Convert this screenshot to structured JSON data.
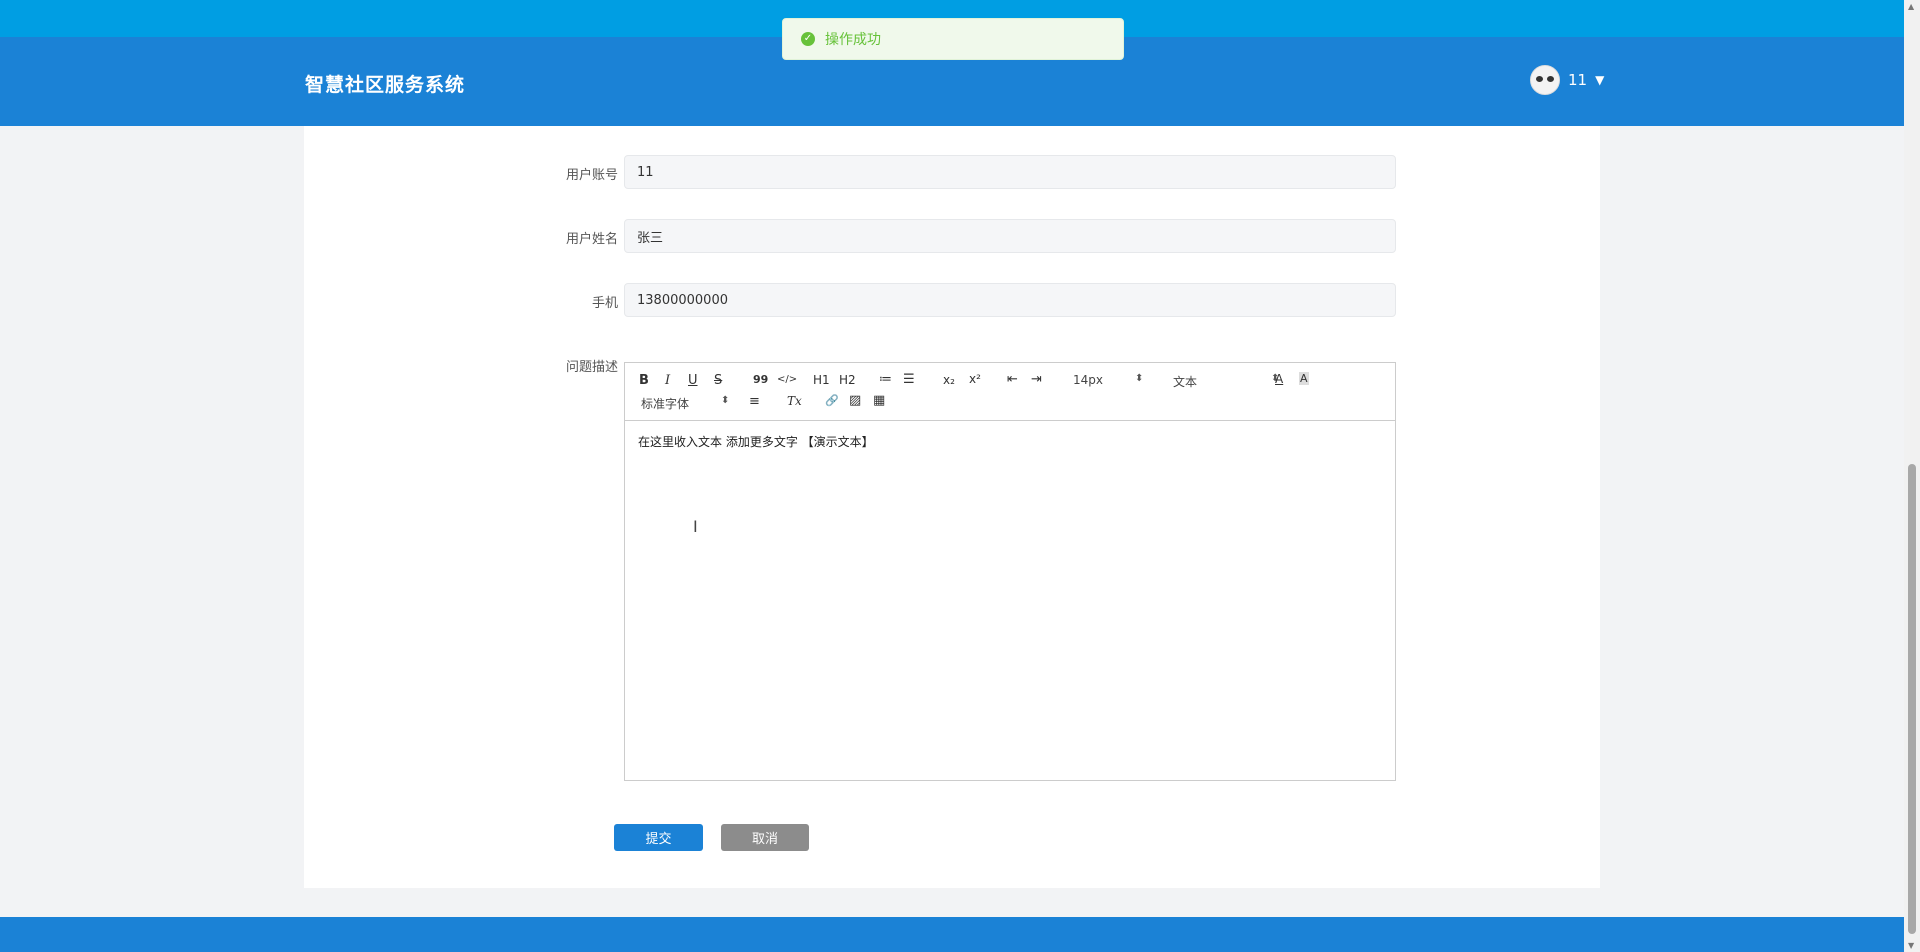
{
  "header": {
    "title": "智慧社区服务系统",
    "user_name": "11"
  },
  "toast": {
    "message": "操作成功"
  },
  "form": {
    "account_label": "用户账号",
    "account_value": "11",
    "name_label": "用户姓名",
    "name_value": "张三",
    "phone_label": "手机",
    "phone_value": "13800000000",
    "desc_label": "问题描述"
  },
  "editor": {
    "font_size": "14px",
    "header_select": "文本",
    "font_family": "标准字体",
    "content": "在这里收入文本 添加更多文字 【演示文本】",
    "tools": {
      "bold": "B",
      "italic": "I",
      "underline": "U",
      "strike": "S",
      "quote": "99",
      "code": "</>",
      "h1": "H1",
      "h2": "H2",
      "ordered_list": "≔",
      "bullet_list": "☰",
      "sub": "x₂",
      "sup": "x²",
      "outdent": "⇤",
      "indent": "⇥",
      "color": "A",
      "background": "A",
      "align": "≡",
      "clean": "Tx",
      "link": "🔗",
      "image": "▨",
      "video": "▦"
    }
  },
  "buttons": {
    "submit": "提交",
    "cancel": "取消"
  }
}
